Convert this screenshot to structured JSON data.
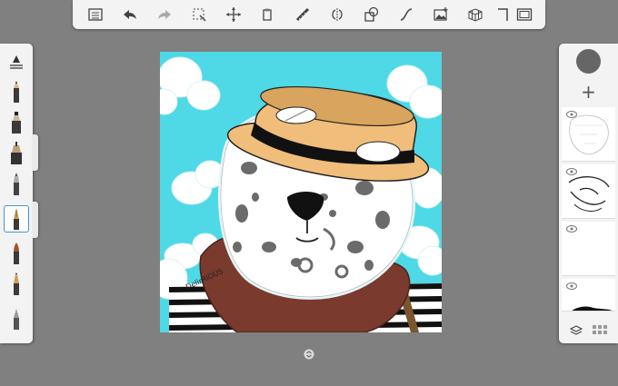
{
  "toolbar": {
    "tools": [
      "list-icon",
      "undo-icon",
      "redo-icon",
      "selection-icon",
      "transform-icon",
      "fill-icon",
      "ruler-icon",
      "symmetry-icon",
      "shape-icon",
      "curve-icon",
      "image-icon",
      "perspective-icon",
      "crop-icon",
      "fullscreen-icon"
    ]
  },
  "brushes": [
    "brush-settings-icon",
    "pencil-icon",
    "marker-icon",
    "airbrush-icon",
    "paintbrush-icon",
    "ink-pen-icon",
    "felt-brush-icon",
    "chisel-icon",
    "hard-brush-icon"
  ],
  "colors": {
    "panel": "#f3f3f3",
    "background": "#808080",
    "canvas_sky": "#4fd8e6",
    "selection": "#4a90d9",
    "current_color": "#666666"
  },
  "layers": {
    "add_label": "+",
    "count": 5
  },
  "canvas": {
    "signature": "DelirRIOUS"
  }
}
